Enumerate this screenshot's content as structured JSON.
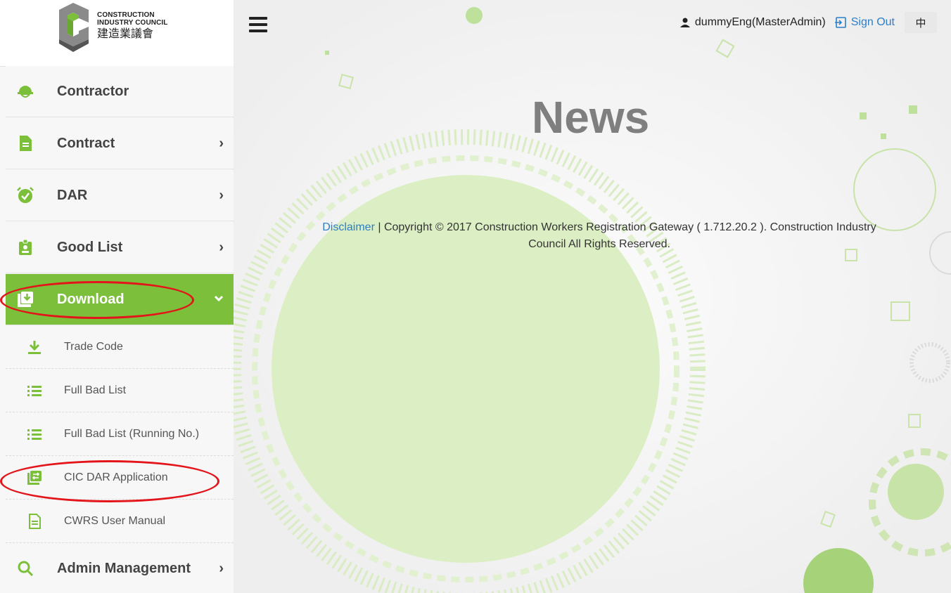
{
  "logo": {
    "en_line1": "CONSTRUCTION",
    "en_line2": "INDUSTRY COUNCIL",
    "zh": "建造業議會"
  },
  "sidebar": {
    "items": [
      {
        "label": "Contractor",
        "icon": "hardhat-icon"
      },
      {
        "label": "Contract",
        "icon": "document-icon",
        "chevron": "›"
      },
      {
        "label": "DAR",
        "icon": "alarm-check-icon",
        "chevron": "›"
      },
      {
        "label": "Good List",
        "icon": "badge-icon",
        "chevron": "›"
      },
      {
        "label": "Download",
        "icon": "download-box-icon",
        "chevron": "⌄"
      },
      {
        "label": "Admin Management",
        "icon": "search-icon",
        "chevron": "›"
      }
    ],
    "sub_items": [
      {
        "label": "Trade Code",
        "icon": "download-arrow-icon"
      },
      {
        "label": "Full Bad List",
        "icon": "list-icon"
      },
      {
        "label": "Full Bad List (Running No.)",
        "icon": "list-icon"
      },
      {
        "label": "CIC DAR Application",
        "icon": "transfer-icon"
      },
      {
        "label": "CWRS User Manual",
        "icon": "document-icon"
      }
    ]
  },
  "header": {
    "username": "dummyEng(MasterAdmin)",
    "sign_out": "Sign Out",
    "lang_toggle": "中"
  },
  "main": {
    "title": "News",
    "disclaimer_link": "Disclaimer",
    "footer_line1": " | Copyright © 2017 Construction Workers Registration Gateway ( 1.712.20.2 ). Construction Industry",
    "footer_line2": "Council All Rights Reserved."
  },
  "colors": {
    "accent": "#7bbf3a",
    "link": "#2c7ec9",
    "annotation": "#e3151b"
  }
}
